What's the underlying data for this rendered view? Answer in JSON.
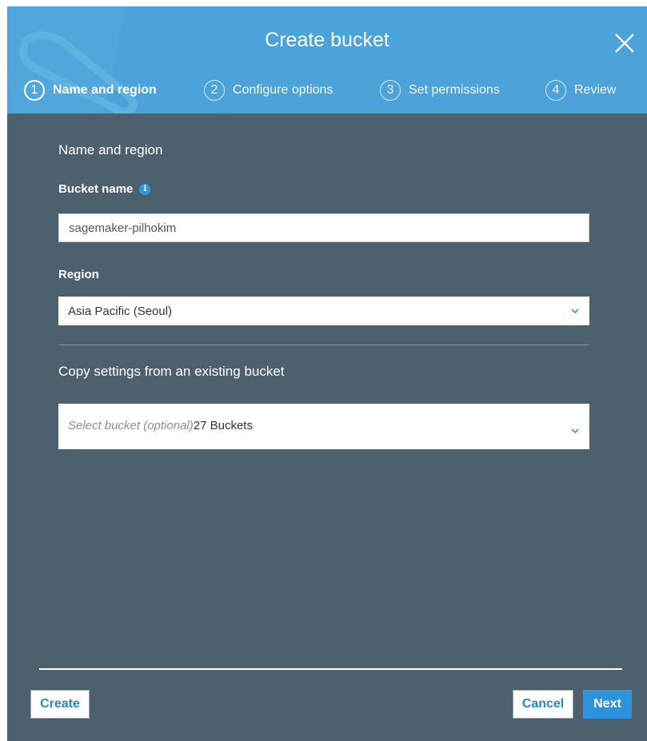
{
  "dialog": {
    "title": "Create bucket",
    "close_icon": "close-icon"
  },
  "steps": [
    {
      "number": "1",
      "label": "Name and region",
      "active": true
    },
    {
      "number": "2",
      "label": "Configure options",
      "active": false
    },
    {
      "number": "3",
      "label": "Set permissions",
      "active": false
    },
    {
      "number": "4",
      "label": "Review",
      "active": false
    }
  ],
  "form": {
    "section_title": "Name and region",
    "bucket_name": {
      "label": "Bucket name",
      "info_icon": "info-icon",
      "value": "sagemaker-pilhokim"
    },
    "region": {
      "label": "Region",
      "value": "Asia Pacific (Seoul)"
    },
    "copy_settings": {
      "title": "Copy settings from an existing bucket",
      "placeholder": "Select bucket (optional)",
      "count": "27 Buckets"
    }
  },
  "footer": {
    "create_label": "Create",
    "cancel_label": "Cancel",
    "next_label": "Next"
  },
  "colors": {
    "header_bg": "#4ba3d9",
    "body_bg": "#4c606d",
    "primary_button": "#2d93dc",
    "link_text": "#2b84c6"
  }
}
